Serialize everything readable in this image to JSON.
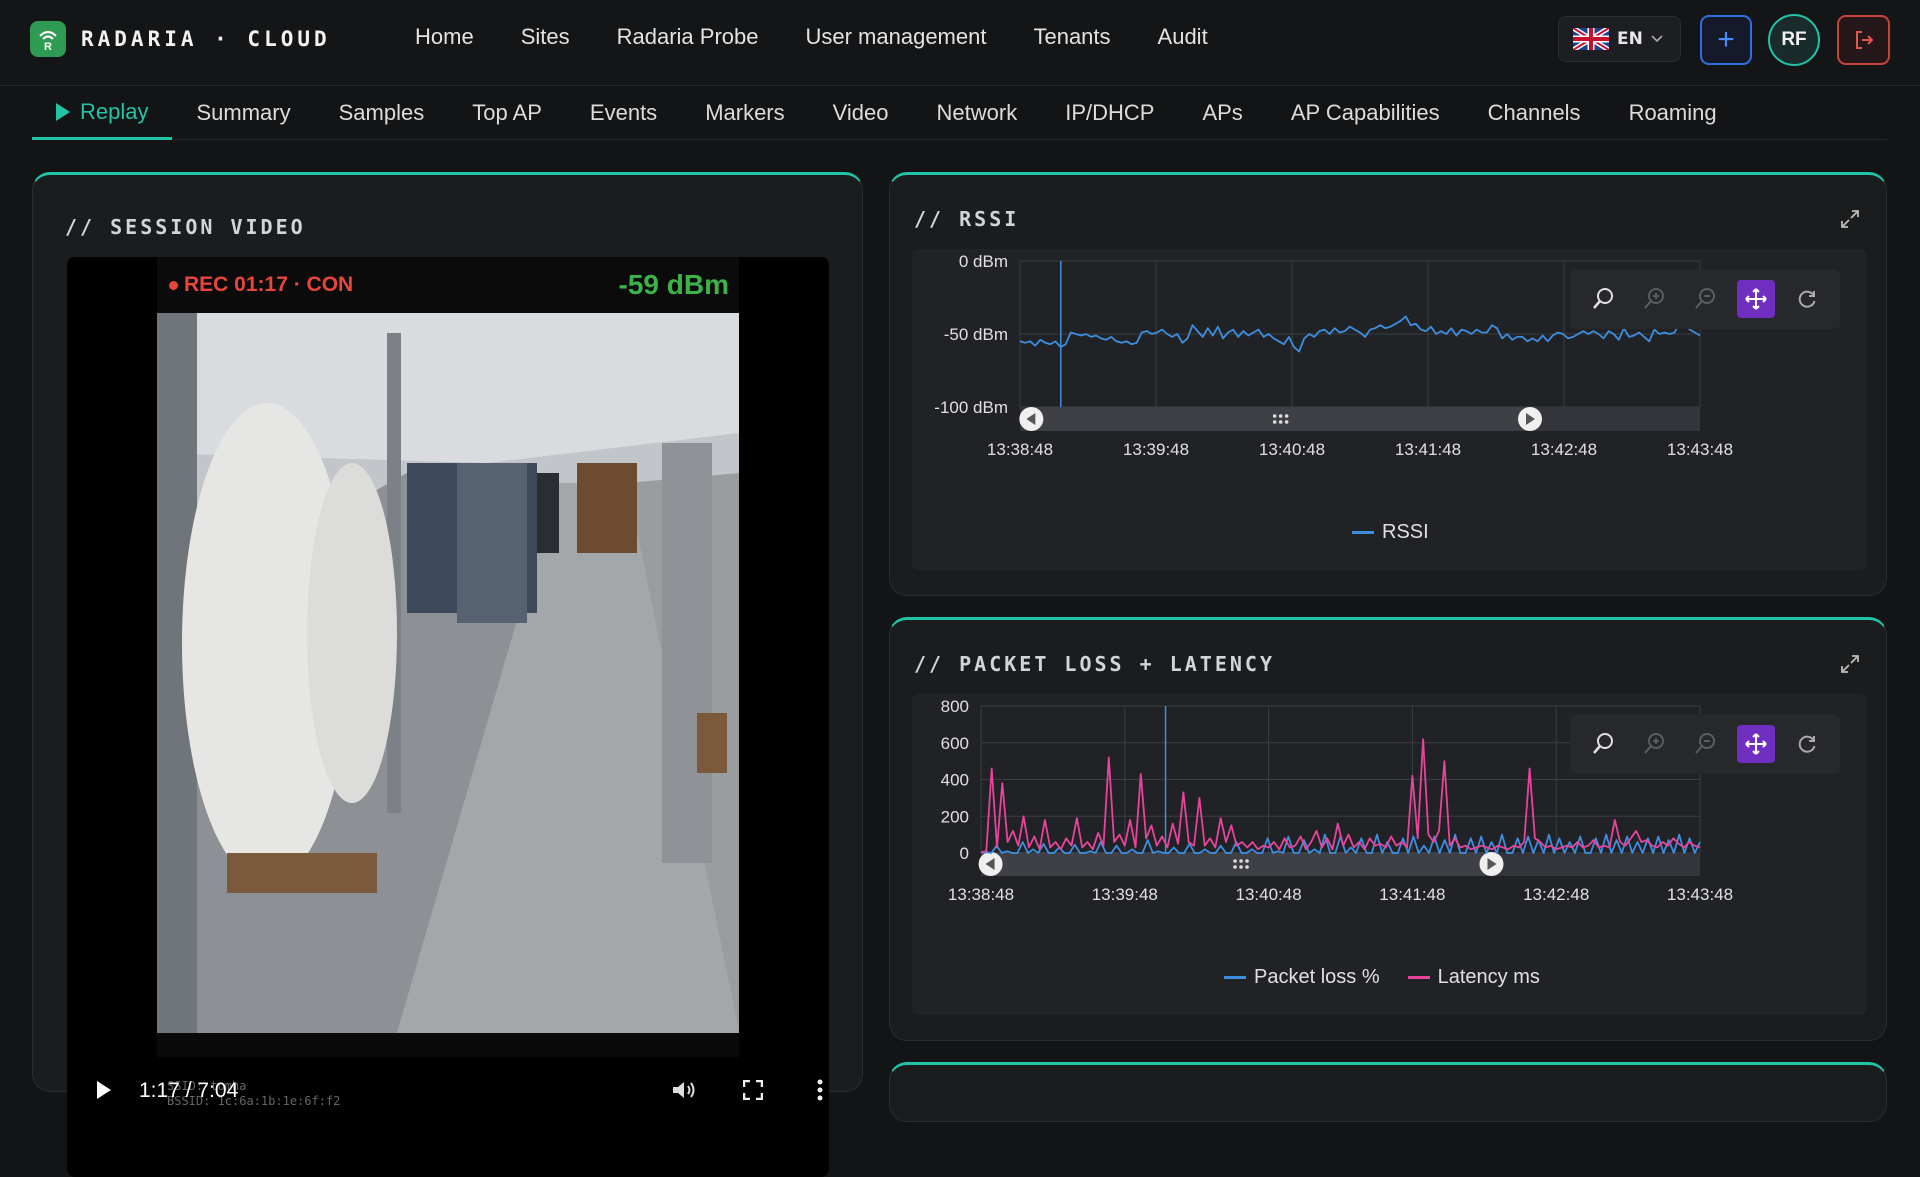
{
  "brand": {
    "name": "RADARIA · CLOUD"
  },
  "nav": [
    "Home",
    "Sites",
    "Radaria Probe",
    "User management",
    "Tenants",
    "Audit"
  ],
  "header": {
    "lang": "EN",
    "add_label": "+",
    "avatar_initials": "RF"
  },
  "tabs": [
    {
      "label": "Replay",
      "active": true
    },
    {
      "label": "Summary"
    },
    {
      "label": "Samples"
    },
    {
      "label": "Top AP"
    },
    {
      "label": "Events"
    },
    {
      "label": "Markers"
    },
    {
      "label": "Video"
    },
    {
      "label": "Network"
    },
    {
      "label": "IP/DHCP"
    },
    {
      "label": "APs"
    },
    {
      "label": "AP Capabilities"
    },
    {
      "label": "Channels"
    },
    {
      "label": "Roaming"
    }
  ],
  "video_panel": {
    "title": "// SESSION VIDEO",
    "rec": "REC 01:17 · CON",
    "signal": "-59 dBm",
    "time": "1:17 / 7:04",
    "ssid_line1": "SSID: tomha",
    "ssid_line2": "BSSID: 1c:6a:1b:1e:6f:f2"
  },
  "rssi_panel": {
    "title": "// RSSI"
  },
  "loss_panel": {
    "title": "// PACKET LOSS + LATENCY"
  },
  "icons": {
    "zoom": "search-icon",
    "zoom_in": "zoom-in-icon",
    "zoom_out": "zoom-out-icon",
    "pan": "move-icon",
    "reset": "refresh-icon",
    "expand": "expand-icon",
    "logout": "logout-icon"
  },
  "colors": {
    "accent": "#22c4a8",
    "rssi": "#3d8ee0",
    "loss": "#3d8ee0",
    "latency": "#e8449c",
    "rec": "#e8453c",
    "signal": "#3cb34a",
    "pan_active": "#6f2ebf"
  },
  "chart_data": [
    {
      "type": "line",
      "title": "",
      "ylabel": "",
      "y_ticks": [
        "0 dBm",
        "-50 dBm",
        "-100 dBm"
      ],
      "ylim": [
        -100,
        0
      ],
      "x_ticks": [
        "13:38:48",
        "13:39:48",
        "13:40:48",
        "13:41:48",
        "13:42:48",
        "13:43:48"
      ],
      "cursor": "13:39:06",
      "zoom_window": [
        "13:38:53",
        "13:42:33"
      ],
      "series": [
        {
          "name": "RSSI",
          "values": [
            -55,
            -56,
            -55,
            -58,
            -54,
            -56,
            -57,
            -55,
            -59,
            -57,
            -49,
            -50,
            -51,
            -50,
            -52,
            -51,
            -53,
            -54,
            -52,
            -55,
            -56,
            -55,
            -57,
            -56,
            -49,
            -48,
            -50,
            -49,
            -47,
            -50,
            -52,
            -50,
            -56,
            -53,
            -44,
            -48,
            -52,
            -46,
            -51,
            -45,
            -53,
            -49,
            -47,
            -52,
            -48,
            -51,
            -49,
            -47,
            -52,
            -50,
            -53,
            -55,
            -57,
            -52,
            -59,
            -62,
            -53,
            -50,
            -52,
            -48,
            -47,
            -50,
            -46,
            -49,
            -48,
            -45,
            -47,
            -49,
            -52,
            -47,
            -46,
            -44,
            -46,
            -45,
            -43,
            -41,
            -38,
            -44,
            -43,
            -47,
            -48,
            -45,
            -50,
            -48,
            -50,
            -46,
            -51,
            -47,
            -48,
            -50,
            -47,
            -49,
            -49,
            -44,
            -46,
            -53,
            -50,
            -54,
            -52,
            -52,
            -55,
            -53,
            -55,
            -51,
            -55,
            -51,
            -49,
            -50,
            -53,
            -52,
            -50,
            -48,
            -50,
            -48,
            -50,
            -53,
            -48,
            -50,
            -54,
            -46,
            -52,
            -51,
            -49,
            -52,
            -55,
            -47,
            -50,
            -49,
            -50,
            -49,
            -42,
            -44,
            -47,
            -49,
            -51
          ]
        }
      ]
    },
    {
      "type": "line",
      "title": "",
      "y_ticks": [
        "800",
        "600",
        "400",
        "200",
        "0"
      ],
      "ylim": [
        0,
        800
      ],
      "x_ticks": [
        "13:38:48",
        "13:39:48",
        "13:40:48",
        "13:41:48",
        "13:42:48",
        "13:43:48"
      ],
      "cursor": "13:40:05",
      "zoom_window": [
        "13:38:52",
        "13:42:21"
      ],
      "series": [
        {
          "name": "Packet loss %",
          "values": [
            0,
            5,
            0,
            40,
            0,
            10,
            0,
            0,
            60,
            0,
            20,
            0,
            50,
            0,
            0,
            30,
            0,
            0,
            45,
            0,
            0,
            10,
            0,
            60,
            0,
            0,
            40,
            0,
            0,
            20,
            0,
            0,
            70,
            0,
            10,
            0,
            0,
            30,
            0,
            0,
            50,
            0,
            0,
            20,
            0,
            0,
            40,
            0,
            0,
            60,
            0,
            0,
            20,
            0,
            0,
            80,
            0,
            10,
            0,
            90,
            0,
            0,
            70,
            0,
            20,
            0,
            100,
            0,
            0,
            90,
            0,
            30,
            0,
            80,
            0,
            0,
            100,
            0,
            60,
            0,
            0,
            80,
            0,
            90,
            0,
            40,
            0,
            90,
            0,
            70,
            0,
            100,
            0,
            0,
            80,
            0,
            90,
            0,
            60,
            0,
            100,
            0,
            0,
            80,
            0,
            90,
            0,
            70,
            0,
            100,
            0,
            80,
            0,
            60,
            0,
            90,
            0,
            0,
            80,
            0,
            100,
            0,
            70,
            0,
            90,
            0,
            60,
            0,
            80,
            0,
            90,
            0,
            70,
            0,
            100,
            0,
            80,
            0,
            60
          ]
        },
        {
          "name": "Latency ms",
          "values": [
            5,
            10,
            460,
            30,
            380,
            60,
            120,
            40,
            200,
            30,
            90,
            20,
            180,
            30,
            60,
            20,
            80,
            40,
            190,
            30,
            60,
            20,
            110,
            40,
            520,
            60,
            100,
            40,
            180,
            30,
            430,
            80,
            150,
            40,
            90,
            30,
            160,
            50,
            330,
            60,
            40,
            300,
            40,
            80,
            30,
            190,
            60,
            150,
            40,
            60,
            30,
            60,
            20,
            40,
            30,
            60,
            20,
            80,
            30,
            40,
            90,
            20,
            60,
            120,
            30,
            80,
            20,
            160,
            40,
            100,
            30,
            60,
            20,
            80,
            40,
            50,
            30,
            90,
            40,
            60,
            30,
            420,
            80,
            620,
            100,
            60,
            120,
            500,
            40,
            80,
            30,
            40,
            20,
            30,
            40,
            30,
            20,
            40,
            30,
            20,
            40,
            30,
            60,
            460,
            80,
            60,
            30,
            40,
            20,
            30,
            40,
            30,
            60,
            30,
            40,
            70,
            30,
            40,
            30,
            180,
            60,
            40,
            80,
            120,
            60,
            70,
            40,
            30,
            60,
            40,
            80,
            50,
            30,
            60,
            40,
            30
          ]
        }
      ]
    }
  ]
}
